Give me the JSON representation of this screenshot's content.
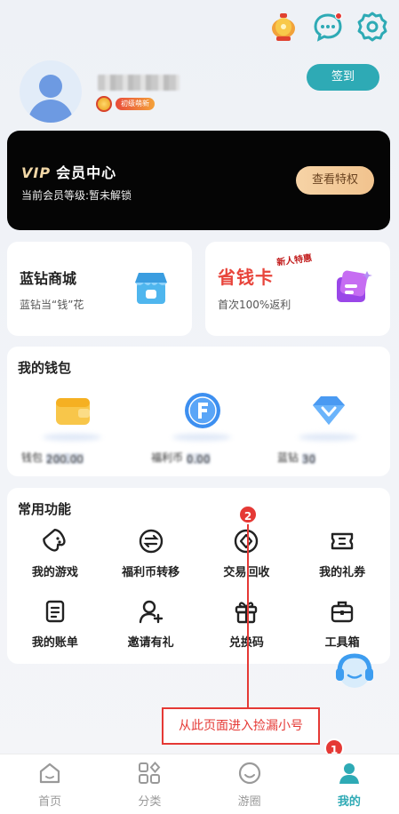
{
  "header": {
    "icons": [
      "lantern-icon",
      "message-icon",
      "settings-icon"
    ]
  },
  "profile": {
    "badge_label": "初级萌新",
    "signin_label": "签到"
  },
  "vip": {
    "logo": "VIP",
    "title": "会员中心",
    "level_text": "当前会员等级:暂未解锁",
    "button_label": "查看特权"
  },
  "cards": {
    "lanzuan": {
      "title": "蓝钻商城",
      "subtitle": "蓝钻当“钱”花"
    },
    "savecard": {
      "title": "省钱卡",
      "tag": "新人特惠",
      "subtitle": "首次100%返利"
    }
  },
  "wallet": {
    "title": "我的钱包",
    "items": [
      {
        "label": "钱包",
        "value": "200.00"
      },
      {
        "label": "福利币",
        "value": "0.00"
      },
      {
        "label": "蓝钻",
        "value": "30"
      }
    ]
  },
  "functions": {
    "title": "常用功能",
    "items": [
      {
        "label": "我的游戏",
        "icon": "gamepad-icon"
      },
      {
        "label": "福利币转移",
        "icon": "transfer-icon"
      },
      {
        "label": "交易回收",
        "icon": "trade-recycle-icon"
      },
      {
        "label": "我的礼券",
        "icon": "coupon-icon"
      },
      {
        "label": "我的账单",
        "icon": "bill-icon"
      },
      {
        "label": "邀请有礼",
        "icon": "invite-user-icon"
      },
      {
        "label": "兑换码",
        "icon": "gift-box-icon"
      },
      {
        "label": "工具箱",
        "icon": "toolbox-icon"
      }
    ]
  },
  "annotation": {
    "marker_1": "1",
    "marker_2": "2",
    "text": "从此页面进入捡漏小号"
  },
  "tabbar": {
    "active": "我的",
    "tabs": [
      {
        "label": "首页",
        "icon": "home-icon"
      },
      {
        "label": "分类",
        "icon": "category-icon"
      },
      {
        "label": "游圈",
        "icon": "community-icon"
      },
      {
        "label": "我的",
        "icon": "user-icon"
      }
    ]
  },
  "colors": {
    "accent": "#2eaab5",
    "vip_bg": "#050505",
    "vip_button": "#f1c38e",
    "annotation_red": "#e53935",
    "save_card_red": "#e8453c"
  }
}
